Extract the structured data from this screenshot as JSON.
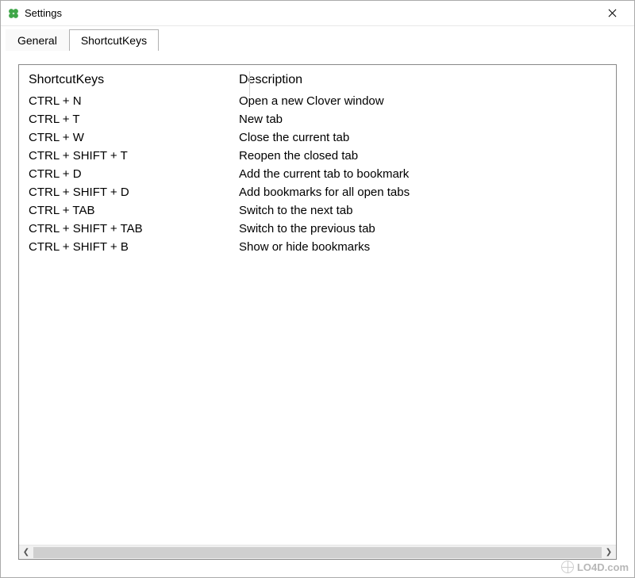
{
  "window": {
    "title": "Settings"
  },
  "tabs": [
    {
      "label": "General",
      "active": false
    },
    {
      "label": "ShortcutKeys",
      "active": true
    }
  ],
  "table": {
    "headers": {
      "key": "ShortcutKeys",
      "desc": "Description"
    },
    "rows": [
      {
        "key": "CTRL + N",
        "desc": "Open a new Clover window"
      },
      {
        "key": "CTRL + T",
        "desc": "New tab"
      },
      {
        "key": "CTRL + W",
        "desc": "Close the current tab"
      },
      {
        "key": "CTRL + SHIFT + T",
        "desc": "Reopen the closed tab"
      },
      {
        "key": "CTRL + D",
        "desc": "Add the current tab to bookmark"
      },
      {
        "key": "CTRL + SHIFT + D",
        "desc": "Add bookmarks for all open tabs"
      },
      {
        "key": "CTRL + TAB",
        "desc": "Switch to the next tab"
      },
      {
        "key": "CTRL + SHIFT + TAB",
        "desc": "Switch to the previous tab"
      },
      {
        "key": "CTRL + SHIFT + B",
        "desc": "Show or hide bookmarks"
      }
    ]
  },
  "watermark": {
    "text": "LO4D.com"
  }
}
